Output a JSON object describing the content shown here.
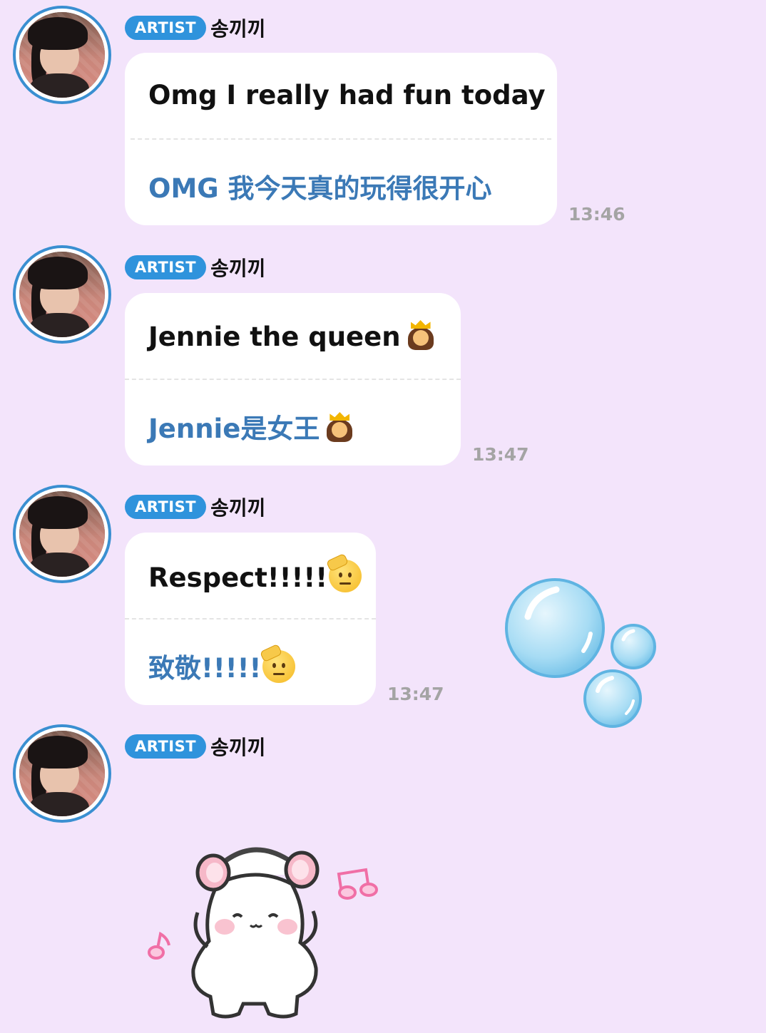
{
  "messages": [
    {
      "badge": "ARTIST",
      "sender": "송끼끼",
      "original": "Omg I really had fun today",
      "translation": "OMG 我今天真的玩得很开心",
      "time": "13:46"
    },
    {
      "badge": "ARTIST",
      "sender": "송끼끼",
      "original": "Jennie the queen",
      "original_emoji": "princess-emoji",
      "translation": "Jennie是女王",
      "translation_emoji": "princess-emoji",
      "time": "13:47"
    },
    {
      "badge": "ARTIST",
      "sender": "송끼끼",
      "original": "Respect!!!!!",
      "original_emoji": "saluting-face-emoji",
      "translation": "致敬!!!!!",
      "translation_emoji": "saluting-face-emoji",
      "time": "13:47"
    },
    {
      "badge": "ARTIST",
      "sender": "송끼끼",
      "sticker": "white-cat-headphones-sticker"
    }
  ],
  "colors": {
    "background": "#f3e4fb",
    "badge": "#2f93dc",
    "translation_text": "#3b79b6",
    "time_text": "#a4a4a4",
    "avatar_ring": "#3a8fd1"
  }
}
